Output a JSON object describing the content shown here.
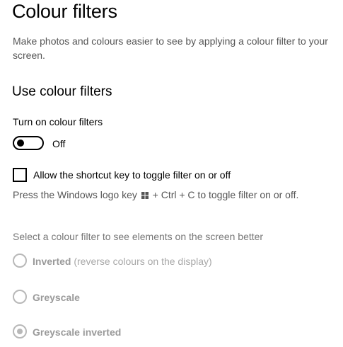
{
  "header": {
    "title": "Colour filters",
    "description": "Make photos and colours easier to see by applying a colour filter to your screen."
  },
  "section": {
    "title": "Use colour filters"
  },
  "toggle": {
    "label": "Turn on colour filters",
    "state_text": "Off",
    "on": false
  },
  "shortcut": {
    "checkbox_label": "Allow the shortcut key to toggle filter on or off",
    "checked": false,
    "hint_before_icon": "Press the Windows logo key",
    "hint_icon": "windows-logo-icon",
    "hint_after_icon": "+ Ctrl + C to toggle filter on or off."
  },
  "filters": {
    "label": "Select a colour filter to see elements on the screen better",
    "options": [
      {
        "name": "Inverted",
        "note": "(reverse colours on the display)",
        "selected": false
      },
      {
        "name": "Greyscale",
        "note": "",
        "selected": false
      },
      {
        "name": "Greyscale inverted",
        "note": "",
        "selected": true
      }
    ]
  },
  "colors": {
    "text": "#000000",
    "secondary_text": "#555555",
    "disabled": "#b8b8b8"
  }
}
